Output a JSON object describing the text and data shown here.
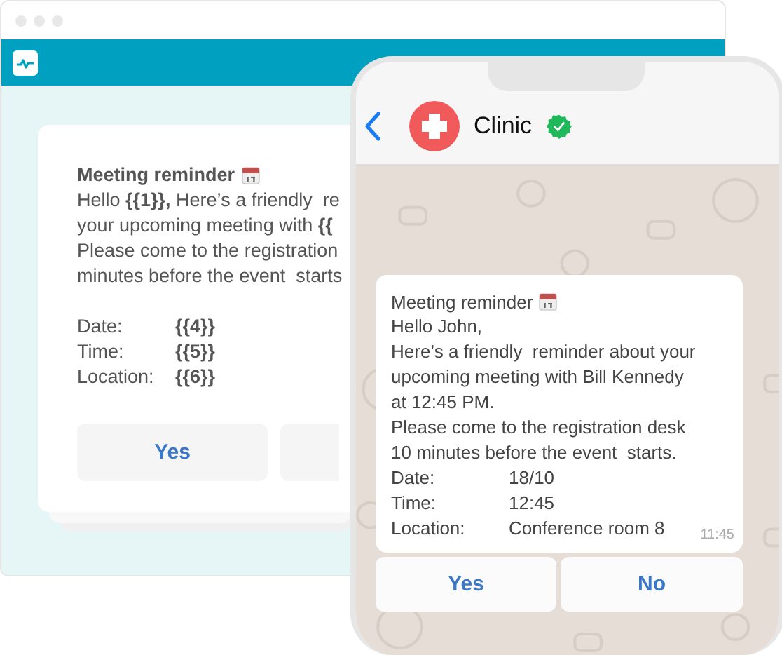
{
  "browser": {
    "template": {
      "title": "Meeting reminder",
      "lines": [
        "Hello **{{1}},** Here’s a friendly  re",
        "your upcoming meeting with **{{**",
        "Please come to the registration",
        "minutes before the event  starts"
      ],
      "fields": [
        {
          "label": "Date:",
          "value": "{{4}}"
        },
        {
          "label": "Time:",
          "value": "{{5}}"
        },
        {
          "label": "Location:",
          "value": "{{6}}"
        }
      ],
      "buttons": [
        {
          "label": "Yes"
        }
      ]
    }
  },
  "phone": {
    "contact": "Clinic",
    "verified": true,
    "message": {
      "title": "Meeting reminder",
      "lines": [
        "Hello John,",
        "Here’s a friendly  reminder about your",
        "upcoming meeting with Bill Kennedy",
        "at 12:45 PM.",
        "Please come to the registration desk",
        "10 minutes before the event  starts."
      ],
      "fields": [
        {
          "label": "Date:",
          "value": "18/10"
        },
        {
          "label": "Time:",
          "value": "12:45"
        },
        {
          "label": "Location:",
          "value": "Conference room 8"
        }
      ],
      "time": "11:45"
    },
    "buttons": [
      "Yes",
      "No"
    ]
  }
}
